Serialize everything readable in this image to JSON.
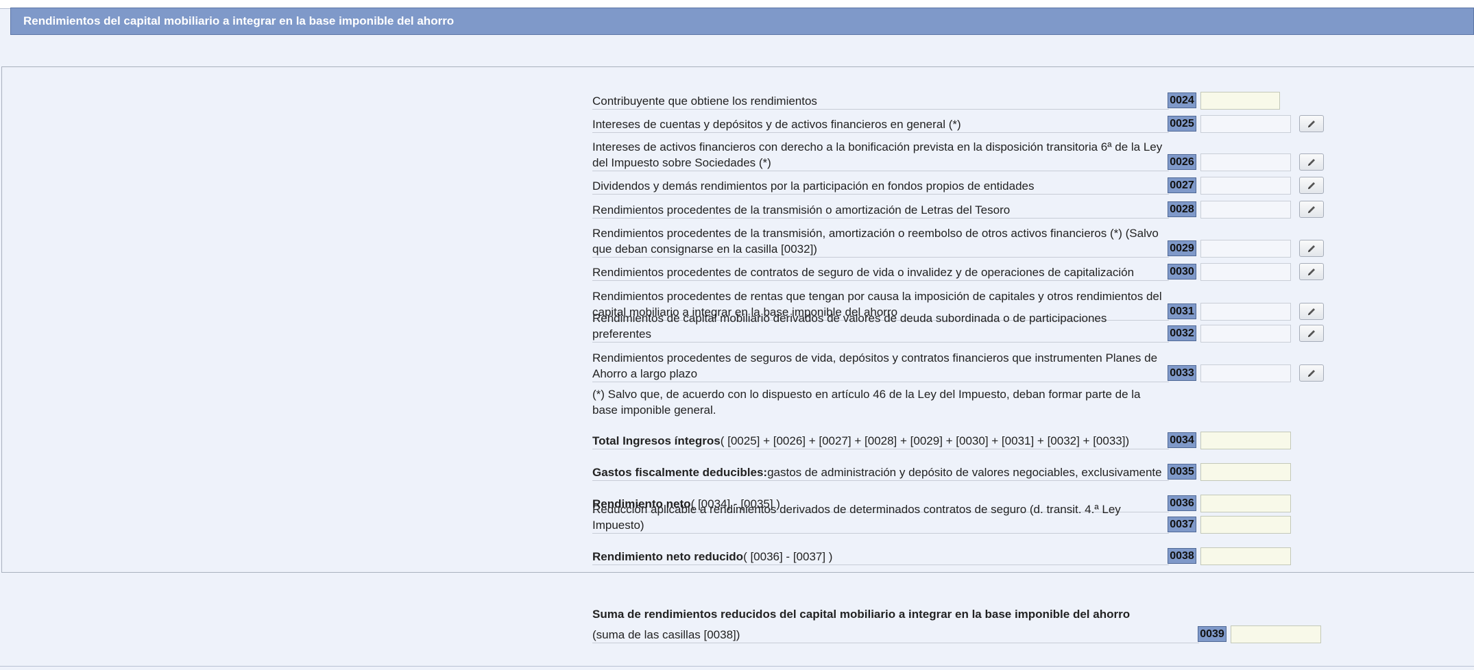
{
  "header": {
    "title": "Rendimientos del capital mobiliario a integrar en la base imponible del ahorro"
  },
  "rows": {
    "r0024": {
      "label": "Contribuyente que obtiene los rendimientos",
      "code": "0024",
      "value": ""
    },
    "r0025": {
      "label": "Intereses de cuentas y depósitos y de activos financieros en general (*)",
      "code": "0025",
      "value": ""
    },
    "r0026": {
      "label": "Intereses de activos financieros con derecho a la bonificación prevista en la disposición transitoria 6ª de la Ley del Impuesto sobre Sociedades (*)",
      "code": "0026",
      "value": ""
    },
    "r0027": {
      "label": "Dividendos y demás rendimientos por la participación en fondos propios de entidades",
      "code": "0027",
      "value": ""
    },
    "r0028": {
      "label": "Rendimientos procedentes de la transmisión o amortización de Letras del Tesoro",
      "code": "0028",
      "value": ""
    },
    "r0029": {
      "label": "Rendimientos procedentes de la transmisión, amortización o reembolso de otros activos financieros (*) (Salvo que deban consignarse en la casilla [0032])",
      "code": "0029",
      "value": ""
    },
    "r0030": {
      "label": "Rendimientos procedentes de contratos de seguro de vida o invalidez y de operaciones de capitalización",
      "code": "0030",
      "value": ""
    },
    "r0031": {
      "label": "Rendimientos procedentes de rentas que tengan por causa la imposición de capitales y otros rendimientos del capital mobiliario a integrar en la base imponible del ahorro",
      "code": "0031",
      "value": ""
    },
    "r0032": {
      "label": "Rendimientos de capital mobiliario derivados de valores de deuda subordinada o de participaciones preferentes",
      "code": "0032",
      "value": ""
    },
    "r0033": {
      "label": "Rendimientos procedentes de seguros de vida, depósitos y contratos financieros que instrumenten Planes de Ahorro a largo plazo",
      "code": "0033",
      "value": ""
    },
    "r0034": {
      "label_bold": "Total Ingresos íntegros",
      "label_rest": "( [0025] + [0026] + [0027] + [0028] + [0029] + [0030] + [0031] + [0032] + [0033])",
      "code": "0034",
      "value": ""
    },
    "r0035": {
      "label_bold": "Gastos fiscalmente deducibles:",
      "label_rest": "gastos de administración y depósito de valores negociables, exclusivamente",
      "code": "0035",
      "value": ""
    },
    "r0036": {
      "label_bold": "Rendimiento neto",
      "label_rest": "( [0034] - [0035] )",
      "code": "0036",
      "value": ""
    },
    "r0037": {
      "label": "Reducción aplicable a rendimientos derivados de determinados contratos de seguro (d. transit. 4.ª Ley Impuesto)",
      "code": "0037",
      "value": ""
    },
    "r0038": {
      "label_bold": "Rendimiento neto reducido",
      "label_rest": "( [0036] - [0037] )",
      "code": "0038",
      "value": ""
    },
    "r0039": {
      "label": "(suma de las casillas [0038])",
      "code": "0039",
      "value": ""
    }
  },
  "note": "(*) Salvo que, de acuerdo con lo dispuesto en artículo 46 de la Ley del Impuesto, deban formar parte de la base imponible general.",
  "summary_title": "Suma de rendimientos reducidos del capital mobiliario a integrar en la base imponible del ahorro",
  "icons": {
    "edit": "pencil-icon"
  },
  "colors": {
    "header_bg": "#7f99c9",
    "code_bg": "#7f99c9",
    "yellow_input": "#f8f9e9"
  }
}
